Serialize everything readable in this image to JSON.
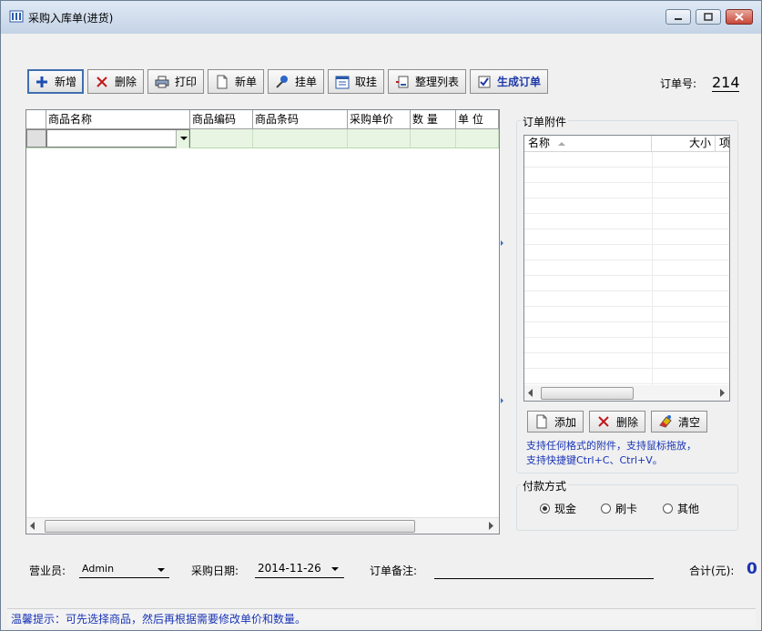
{
  "window": {
    "title": "采购入库单(进货)"
  },
  "toolbar": {
    "add": "新增",
    "delete": "删除",
    "print": "打印",
    "new_doc": "新单",
    "hang": "挂单",
    "fetch_hung": "取挂",
    "arrange_list": "整理列表",
    "gen_order": "生成订单"
  },
  "order": {
    "no_label": "订单号:",
    "no_value": "214"
  },
  "grid": {
    "columns": [
      "商品名称",
      "商品编码",
      "商品条码",
      "采购单价",
      "数 量",
      "单 位"
    ]
  },
  "attachments": {
    "group_title": "订单附件",
    "columns": [
      "名称",
      "大小",
      "项"
    ],
    "add": "添加",
    "delete": "删除",
    "clear": "清空",
    "hint_line1": "支持任何格式的附件，支持鼠标拖放，",
    "hint_line2": "支持快捷键Ctrl+C、Ctrl+V。"
  },
  "payment": {
    "group_title": "付款方式",
    "options": [
      "现金",
      "刷卡",
      "其他"
    ],
    "selected": "现金"
  },
  "footer": {
    "salesman_label": "营业员:",
    "salesman_value": "Admin",
    "date_label": "采购日期:",
    "date_value": "2014-11-26",
    "remark_label": "订单备注:",
    "total_label": "合计(元):",
    "total_value": "0"
  },
  "status": {
    "tip": "温馨提示：可先选择商品，然后再根据需要修改单价和数量。"
  },
  "colors": {
    "accent_blue": "#1a35b5",
    "grid_row_green": "#e8f5e2"
  }
}
